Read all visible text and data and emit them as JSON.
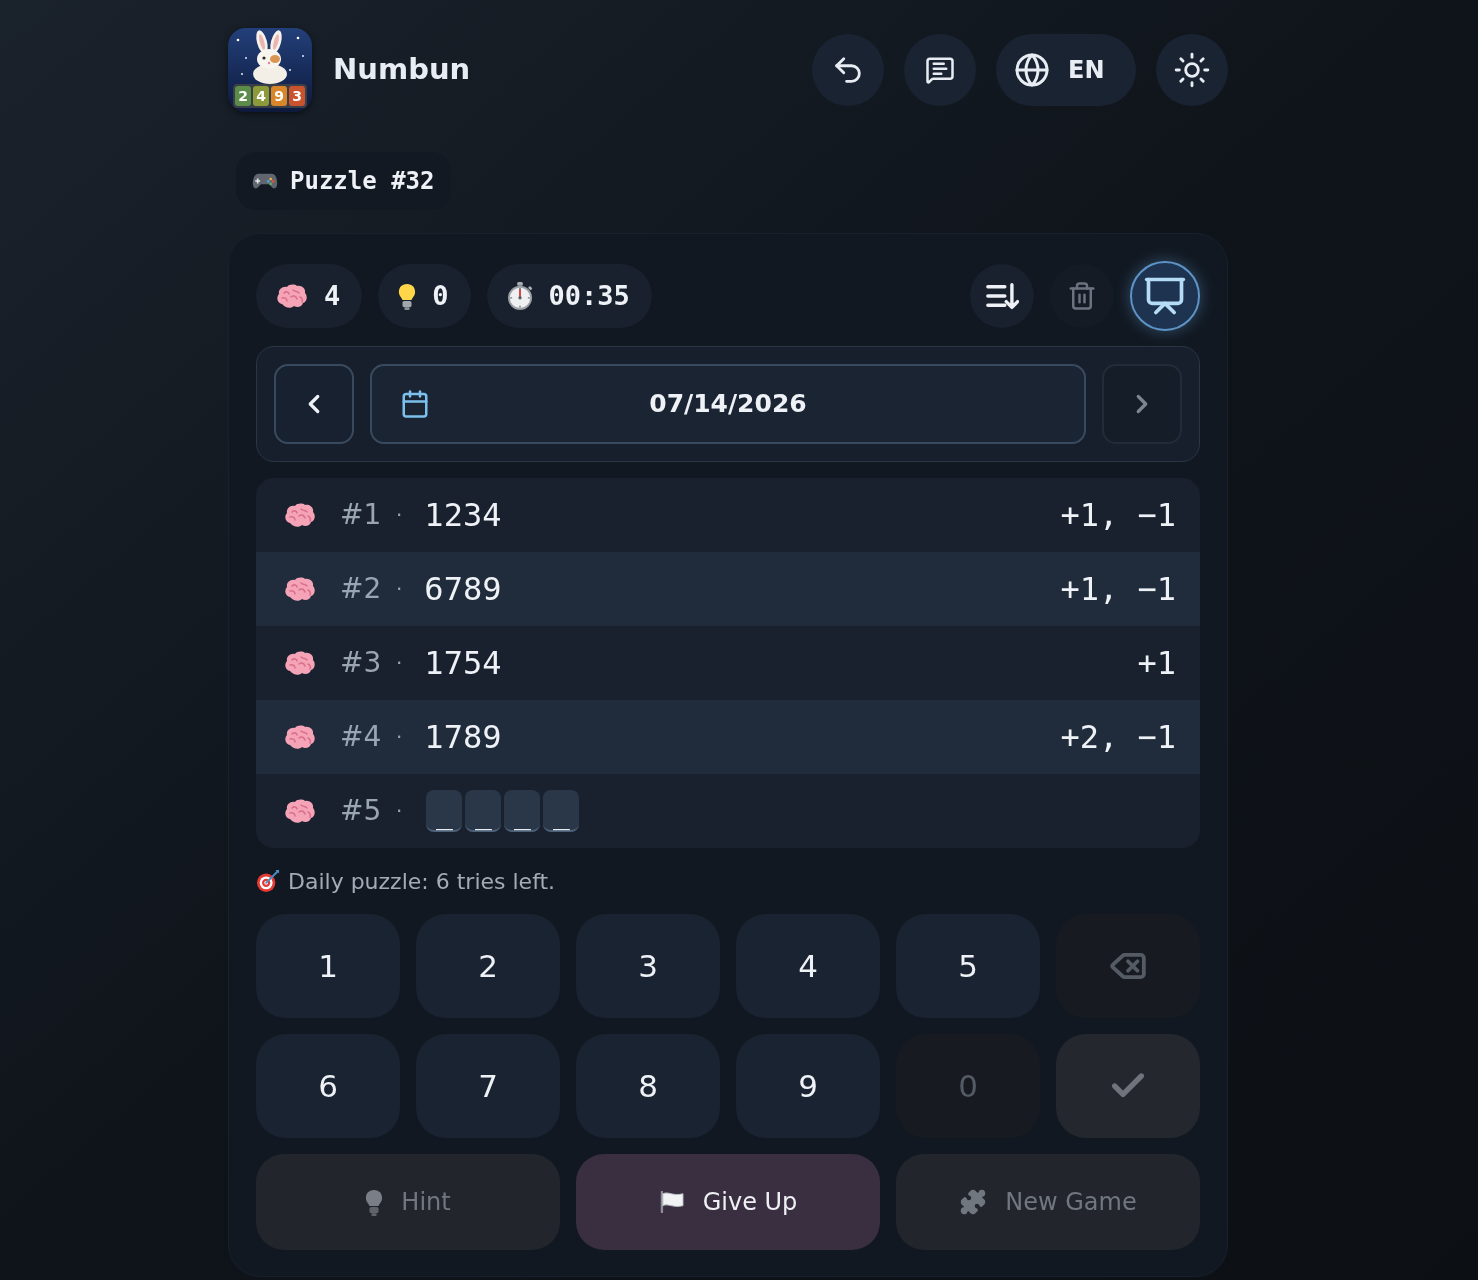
{
  "header": {
    "title": "Numbun",
    "logo_tiles": [
      {
        "digit": "2",
        "color": "#5b8c4a"
      },
      {
        "digit": "4",
        "color": "#8c9a3a"
      },
      {
        "digit": "9",
        "color": "#d9862b"
      },
      {
        "digit": "3",
        "color": "#c9532f"
      }
    ],
    "language": "EN"
  },
  "puzzle": {
    "label": "Puzzle #32"
  },
  "stats": [
    {
      "kind": "guesses",
      "value": "4"
    },
    {
      "kind": "hints",
      "value": "0"
    },
    {
      "kind": "timer",
      "value": "00:35"
    }
  ],
  "tools": [
    {
      "kind": "sort",
      "disabled": false,
      "on": false
    },
    {
      "kind": "clear",
      "disabled": true,
      "on": false
    },
    {
      "kind": "present",
      "disabled": false,
      "on": true
    }
  ],
  "date_nav": {
    "date": "07/14/2026",
    "prev_disabled": false,
    "next_disabled": true
  },
  "guesses": [
    {
      "kind": "guess",
      "number": "#1",
      "separator": "·",
      "guess": "1234",
      "result": "+1, −1"
    },
    {
      "kind": "guess",
      "number": "#2",
      "separator": "·",
      "guess": "6789",
      "result": "+1, −1"
    },
    {
      "kind": "guess",
      "number": "#3",
      "separator": "·",
      "guess": "1754",
      "result": "+1"
    },
    {
      "kind": "guess",
      "number": "#4",
      "separator": "·",
      "guess": "1789",
      "result": "+2, −1"
    },
    {
      "kind": "input",
      "number": "#5",
      "separator": "·",
      "slots": [
        "_",
        "_",
        "_",
        "_"
      ]
    }
  ],
  "status": "Daily puzzle: 6 tries left.",
  "keypad": [
    {
      "kind": "digit",
      "label": "1",
      "disabled": false
    },
    {
      "kind": "digit",
      "label": "2",
      "disabled": false
    },
    {
      "kind": "digit",
      "label": "3",
      "disabled": false
    },
    {
      "kind": "digit",
      "label": "4",
      "disabled": false
    },
    {
      "kind": "digit",
      "label": "5",
      "disabled": false
    },
    {
      "kind": "backspace",
      "disabled": true
    },
    {
      "kind": "digit",
      "label": "6",
      "disabled": false
    },
    {
      "kind": "digit",
      "label": "7",
      "disabled": false
    },
    {
      "kind": "digit",
      "label": "8",
      "disabled": false
    },
    {
      "kind": "digit",
      "label": "9",
      "disabled": false
    },
    {
      "kind": "digit",
      "label": "0",
      "disabled": true
    },
    {
      "kind": "submit",
      "disabled": true
    }
  ],
  "actions": [
    {
      "kind": "hint",
      "label": "Hint",
      "disabled": true
    },
    {
      "kind": "give_up",
      "label": "Give Up",
      "disabled": false
    },
    {
      "kind": "new_game",
      "label": "New Game",
      "disabled": true
    }
  ]
}
